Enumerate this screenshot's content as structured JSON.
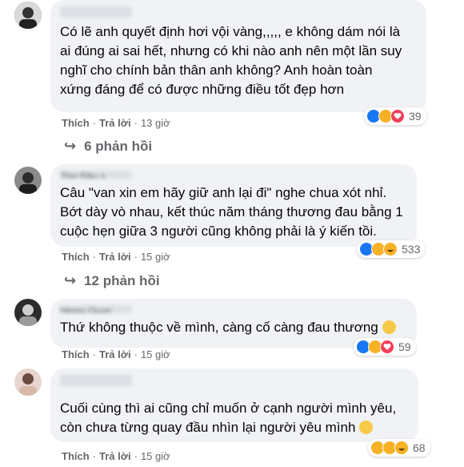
{
  "comments": [
    {
      "text": "Có lẽ anh quyết định hơi vội vàng,,,,, e không dám nói là\nai đúng ai sai hết, nhưng có khi nào anh nên một lần suy\nnghĩ cho chính bản thân anh không? Anh hoàn toàn\nxứng đáng để có được những điều tốt đẹp hơn",
      "like_label": "Thích",
      "reply_label": "Trả lời",
      "time": "13 giờ",
      "reaction_count": "39",
      "replies_label": "6 phản hồi"
    },
    {
      "name_partial": "Thơ Đậu s",
      "text": "Câu \"van xin em hãy giữ anh lại đi\" nghe chua xót nhỉ.\nBớt dày vò nhau, kết thúc năm tháng thương đau bằng 1\ncuộc hẹn giữa 3 người cũng không phải là ý kiến tồi.",
      "like_label": "Thích",
      "reply_label": "Trả lời",
      "time": "15 giờ",
      "reaction_count": "533",
      "replies_label": "12 phản hồi"
    },
    {
      "name_partial": "Henry Quyn",
      "text": "Thứ không thuộc về mình, càng cố càng đau thương",
      "like_label": "Thích",
      "reply_label": "Trả lời",
      "time": "15 giờ",
      "reaction_count": "59"
    },
    {
      "text": "Cuối cùng thì ai cũng chỉ muốn ở cạnh người mình yêu,\ncòn chưa từng quay đầu nhìn lại người yêu mình",
      "like_label": "Thích",
      "reply_label": "Trả lời",
      "time": "15 giờ",
      "reaction_count": "68"
    }
  ],
  "icons": {
    "like": "like-icon",
    "sad": "sad-icon",
    "love": "love-icon",
    "haha": "haha-icon",
    "reply_arrow": "reply-arrow-icon"
  },
  "colors": {
    "bubble": "#f0f2f5",
    "like_blue": "#1877f2",
    "meta_gray": "#65676b"
  }
}
